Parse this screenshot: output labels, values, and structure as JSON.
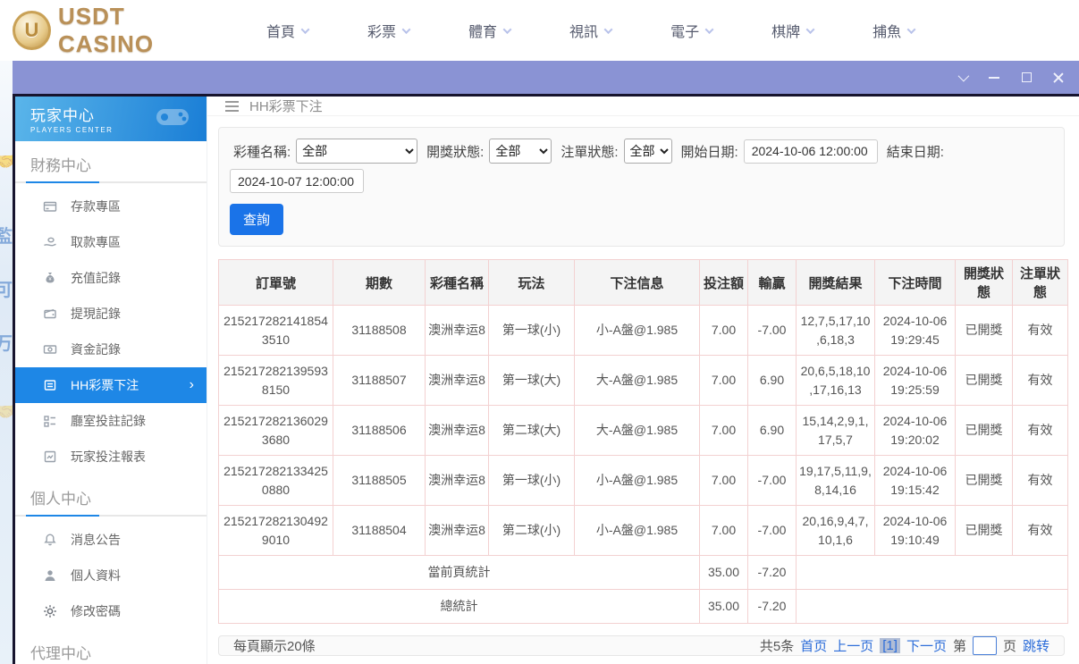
{
  "topnav": {
    "logo_text": "USDT CASINO",
    "logo_letter": "U",
    "items": [
      {
        "label": "首頁"
      },
      {
        "label": "彩票"
      },
      {
        "label": "體育"
      },
      {
        "label": "視訊"
      },
      {
        "label": "電子"
      },
      {
        "label": "棋牌"
      },
      {
        "label": "捕魚"
      }
    ]
  },
  "sidebar": {
    "title": "玩家中心",
    "subtitle": "PLAYERS CENTER",
    "sections": [
      {
        "header": "財務中心",
        "items": [
          {
            "label": "存款專區"
          },
          {
            "label": "取款專區"
          },
          {
            "label": "充值記錄"
          },
          {
            "label": "提現記錄"
          },
          {
            "label": "資金記錄"
          },
          {
            "label": "HH彩票下注",
            "active": true,
            "arrow": "›"
          },
          {
            "label": "廳室投註記錄"
          },
          {
            "label": "玩家投注報表"
          }
        ]
      },
      {
        "header": "個人中心",
        "items": [
          {
            "label": "消息公告"
          },
          {
            "label": "個人資料"
          },
          {
            "label": "修改密碼"
          }
        ]
      },
      {
        "header": "代理中心",
        "items": []
      }
    ]
  },
  "main": {
    "page_title": "HH彩票下注",
    "filters": {
      "lottery_label": "彩種名稱:",
      "lottery_value": "全部",
      "draw_status_label": "開獎狀態:",
      "draw_status_value": "全部",
      "order_status_label": "注單狀態:",
      "order_status_value": "全部",
      "start_label": "開始日期:",
      "start_value": "2024-10-06 12:00:00",
      "end_label": "結束日期:",
      "end_value": "2024-10-07 12:00:00",
      "search_label": "查詢"
    },
    "table": {
      "headers": [
        "訂單號",
        "期數",
        "彩種名稱",
        "玩法",
        "下注信息",
        "投注額",
        "輸贏",
        "開獎結果",
        "下注時間",
        "開獎狀態",
        "注單狀態"
      ],
      "rows": [
        [
          "2152172821418543510",
          "31188508",
          "澳洲幸运8",
          "第一球(小)",
          "小-A盤@1.985",
          "7.00",
          "-7.00",
          "12,7,5,17,10,6,18,3",
          "2024-10-06 19:29:45",
          "已開獎",
          "有效"
        ],
        [
          "2152172821395938150",
          "31188507",
          "澳洲幸运8",
          "第一球(大)",
          "大-A盤@1.985",
          "7.00",
          "6.90",
          "20,6,5,18,10,17,16,13",
          "2024-10-06 19:25:59",
          "已開獎",
          "有效"
        ],
        [
          "2152172821360293680",
          "31188506",
          "澳洲幸运8",
          "第二球(大)",
          "大-A盤@1.985",
          "7.00",
          "6.90",
          "15,14,2,9,1,17,5,7",
          "2024-10-06 19:20:02",
          "已開獎",
          "有效"
        ],
        [
          "2152172821334250880",
          "31188505",
          "澳洲幸运8",
          "第一球(小)",
          "小-A盤@1.985",
          "7.00",
          "-7.00",
          "19,17,5,11,9,8,14,16",
          "2024-10-06 19:15:42",
          "已開獎",
          "有效"
        ],
        [
          "2152172821304929010",
          "31188504",
          "澳洲幸运8",
          "第二球(小)",
          "小-A盤@1.985",
          "7.00",
          "-7.00",
          "20,16,9,4,7,10,1,6",
          "2024-10-06 19:10:49",
          "已開獎",
          "有效"
        ]
      ],
      "summary": [
        {
          "label": "當前頁統計",
          "bet": "35.00",
          "winloss": "-7.20"
        },
        {
          "label": "總統計",
          "bet": "35.00",
          "winloss": "-7.20"
        }
      ]
    },
    "pagination": {
      "page_size_text": "每頁顯示20條",
      "total_text": "共5条",
      "first": "首页",
      "prev": "上一页",
      "current": "[1]",
      "next": "下一页",
      "jump_prefix": "第",
      "jump_value": "",
      "jump_suffix": "页",
      "jump_action": "跳转"
    }
  },
  "colors": {
    "accent_blue": "#1e87e6",
    "button_blue": "#1a73e8",
    "link_blue": "#2b6cd9",
    "titlebar_purple": "#8a93d4",
    "table_border": "#f3d1d1",
    "logo_gold": "#b99058"
  }
}
